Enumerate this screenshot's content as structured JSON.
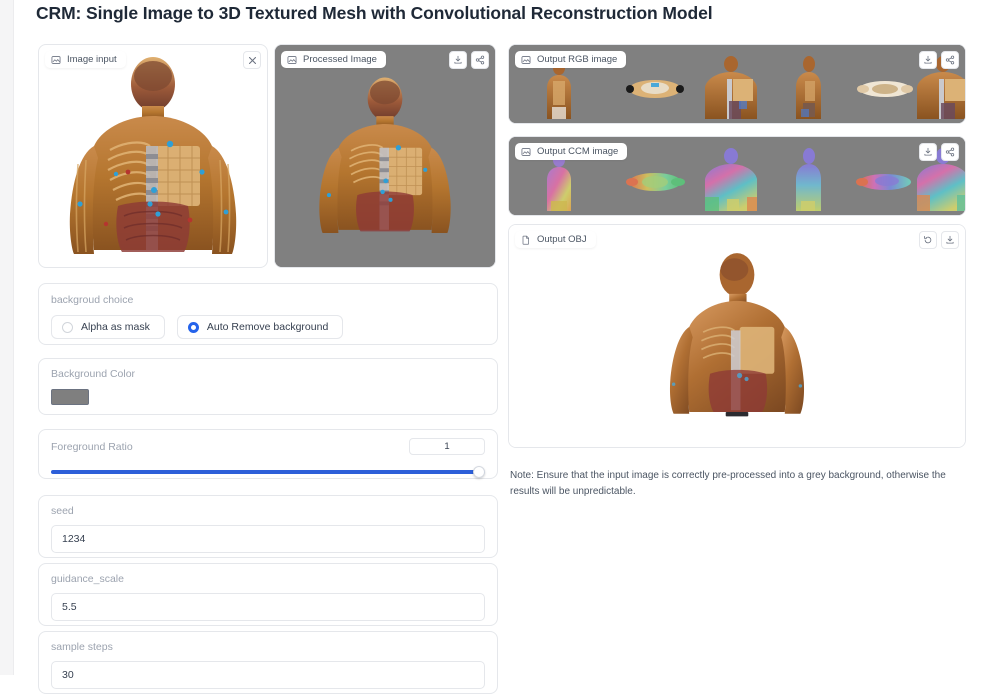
{
  "app": {
    "title": "CRM: Single Image to 3D Textured Mesh with Convolutional Reconstruction Model"
  },
  "panels": {
    "image_input": {
      "label": "Image input",
      "icon": "image-icon",
      "close_label": "✕",
      "background": "#ffffff"
    },
    "processed_image": {
      "label": "Processed Image",
      "icon": "image-icon",
      "background": "#808080"
    },
    "output_rgb": {
      "label": "Output RGB image",
      "icon": "image-icon",
      "background": "#808080",
      "view_count": 6
    },
    "output_ccm": {
      "label": "Output CCM image",
      "icon": "image-icon",
      "background": "#808080",
      "view_count": 6
    },
    "output_obj": {
      "label": "Output OBJ",
      "icon": "file-icon",
      "background": "#ffffff"
    }
  },
  "actions": {
    "download": "download-icon",
    "share": "share-icon",
    "reset": "undo-icon",
    "close": "close-icon"
  },
  "controls": {
    "background_choice": {
      "label": "backgroud choice",
      "options": [
        {
          "label": "Alpha as mask",
          "selected": false
        },
        {
          "label": "Auto Remove background",
          "selected": true
        }
      ],
      "accent": "#2563eb"
    },
    "background_color": {
      "label": "Background Color",
      "value": "#7f7f7f"
    },
    "foreground_ratio": {
      "label": "Foreground Ratio",
      "value": "1",
      "percent": 100,
      "track_color": "#2d5fd9"
    },
    "seed": {
      "label": "seed",
      "value": "1234"
    },
    "guidance_scale": {
      "label": "guidance_scale",
      "value": "5.5"
    },
    "sample_steps": {
      "label": "sample steps",
      "value": "30"
    }
  },
  "note": {
    "text": "Note: Ensure that the input image is correctly pre-processed into a grey background, otherwise the results will be unpredictable."
  }
}
